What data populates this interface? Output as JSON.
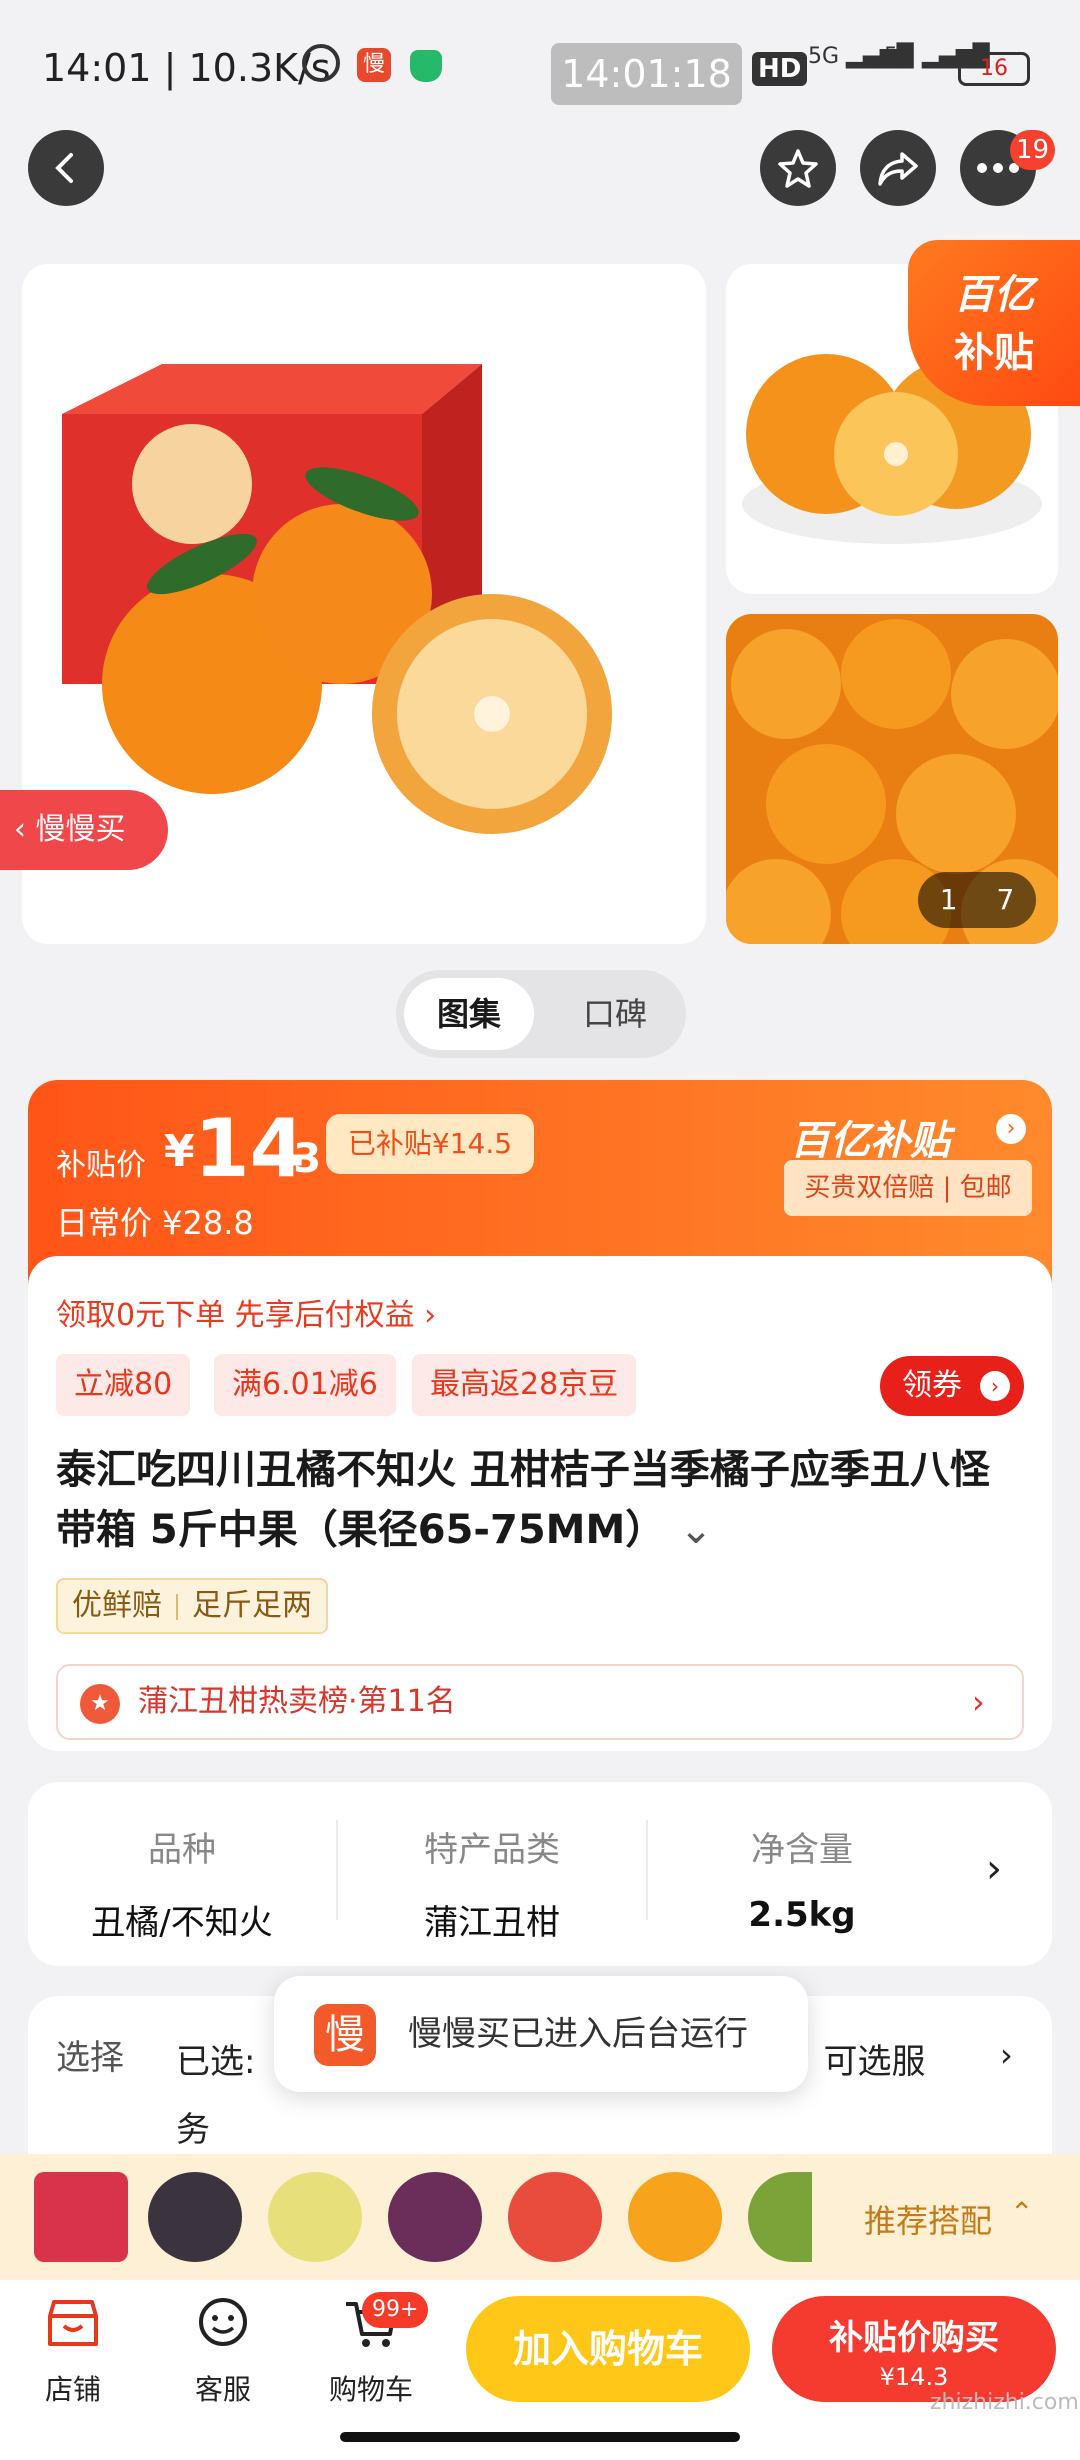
{
  "status_bar": {
    "time_speed": "14:01 | 10.3K/s",
    "app_badge": "慢",
    "clock": "14:01:18",
    "hd": "HD",
    "network1": "5G",
    "network2": "5G",
    "battery": "16"
  },
  "top_bar": {
    "notification_count": "19"
  },
  "gallery": {
    "ribbon_line1": "百亿",
    "ribbon_line2": "补贴",
    "back_app": "慢慢买",
    "page_current": "1",
    "page_total": "7"
  },
  "tabs": [
    {
      "label": "图集",
      "active": true
    },
    {
      "label": "口碑",
      "active": false
    }
  ],
  "price": {
    "label": "补贴价",
    "currency": "¥",
    "integer": "14",
    "decimal": ".3",
    "subsidy_badge": "已补贴¥14.5",
    "daily_price": "日常价 ¥28.8",
    "brand": "百亿补贴",
    "brand_tags": "买贵双倍赔 | 包邮"
  },
  "info": {
    "pay_after": "领取0元下单 先享后付权益 ›",
    "coupons": [
      "立减80",
      "满6.01减6",
      "最高返28京豆"
    ],
    "get_coupon": "领券",
    "title": "泰汇吃四川丑橘不知火 丑柑桔子当季橘子应季丑八怪带箱 5斤中果（果径65-75MM）",
    "tags": [
      "优鲜赔",
      "足斤足两"
    ],
    "ranking": "蒲江丑柑热卖榜·第11名"
  },
  "specs": [
    {
      "label": "品种",
      "value": "丑橘/不知火"
    },
    {
      "label": "特产品类",
      "value": "蒲江丑柑"
    },
    {
      "label": "净含量",
      "value": "2.5kg"
    }
  ],
  "select": {
    "label": "选择",
    "text_prefix": "已选:",
    "text_suffix": "件，可选服",
    "text_line2": "务"
  },
  "toast": {
    "icon": "慢",
    "text": "慢慢买已进入后台运行"
  },
  "recommend": {
    "label": "推荐搭配"
  },
  "bottom": {
    "store": "店铺",
    "service": "客服",
    "cart": "购物车",
    "cart_count": "99+",
    "add_to_cart": "加入购物车",
    "buy_label": "补贴价购买",
    "buy_price": "¥14.3"
  },
  "watermark": "zhizhizhi.com",
  "colors": {
    "accent": "#f53a30",
    "orange": "#ff5518",
    "yellow": "#ffc819"
  }
}
